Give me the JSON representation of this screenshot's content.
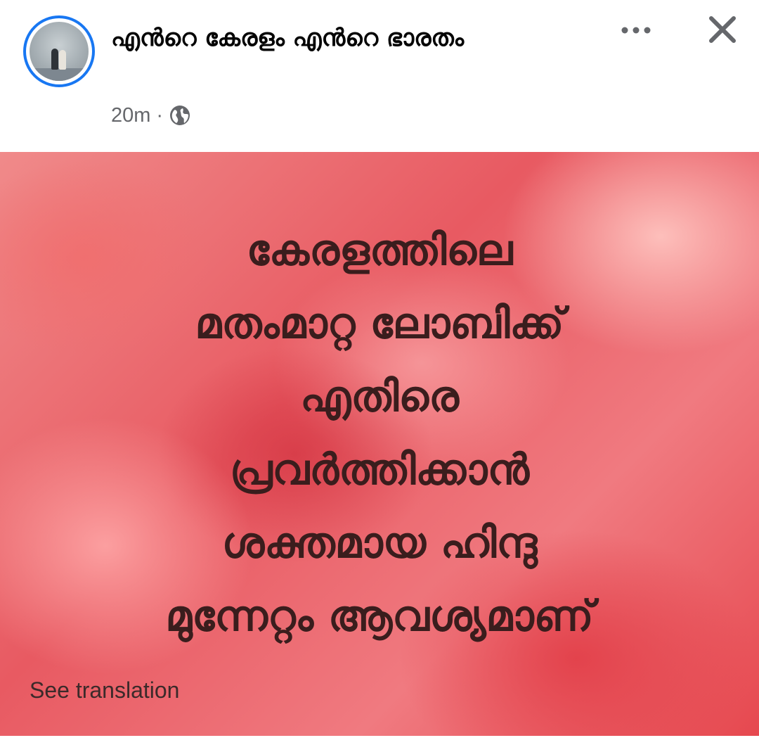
{
  "post": {
    "page_name": "എൻറെ കേരളം എൻറെ ഭാരതം",
    "timestamp": "20m",
    "separator": "·",
    "privacy_icon": "globe-icon",
    "text": "കേരളത്തിലെ\nമതംമാറ്റ ലോബിക്ക്\nഎതിരെ\nപ്രവർത്തിക്കാൻ\nശക്തമായ ഹിന്ദു\nമുന്നേറ്റം ആവശ്യമാണ്",
    "see_translation_label": "See translation"
  },
  "header": {
    "more_icon": "more-options-icon",
    "close_icon": "close-icon"
  },
  "colors": {
    "accent_ring": "#1877f2",
    "post_text": "#3a1d1d",
    "meta_text": "#65676b",
    "background_red": "#e85a62"
  }
}
